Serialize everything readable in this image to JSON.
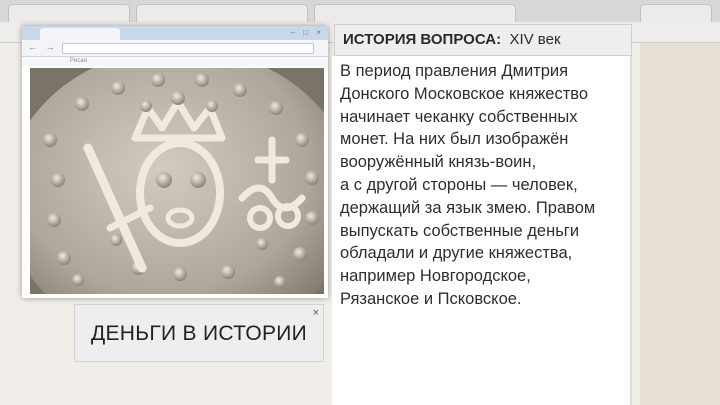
{
  "panel": {
    "title": "ИСТОРИЯ ВОПРОСА:",
    "century": "XIV век",
    "body": "В период правления Дмитрия\nДонского Московское княжество\nначинает чеканку собственных\nмонет. На них был изображён\nвооружённый князь-воин,\nа с другой стороны — человек,\nдержащий за язык змею. Правом\nвыпускать собственные деньги\nобладали и другие княжества,\nнапример Новгородское,\nРязанское и Псковское."
  },
  "caption": {
    "label": "ДЕНЬГИ В ИСТОРИИ",
    "close": "×"
  },
  "mini_browser": {
    "nav": "← → C",
    "bookmark": "Рисая",
    "win_buttons": "– □ ×"
  },
  "colors": {
    "coin_silver": "#b9b2a6",
    "coin_shadow": "#6e6759",
    "header_bg": "#eeeeee"
  }
}
